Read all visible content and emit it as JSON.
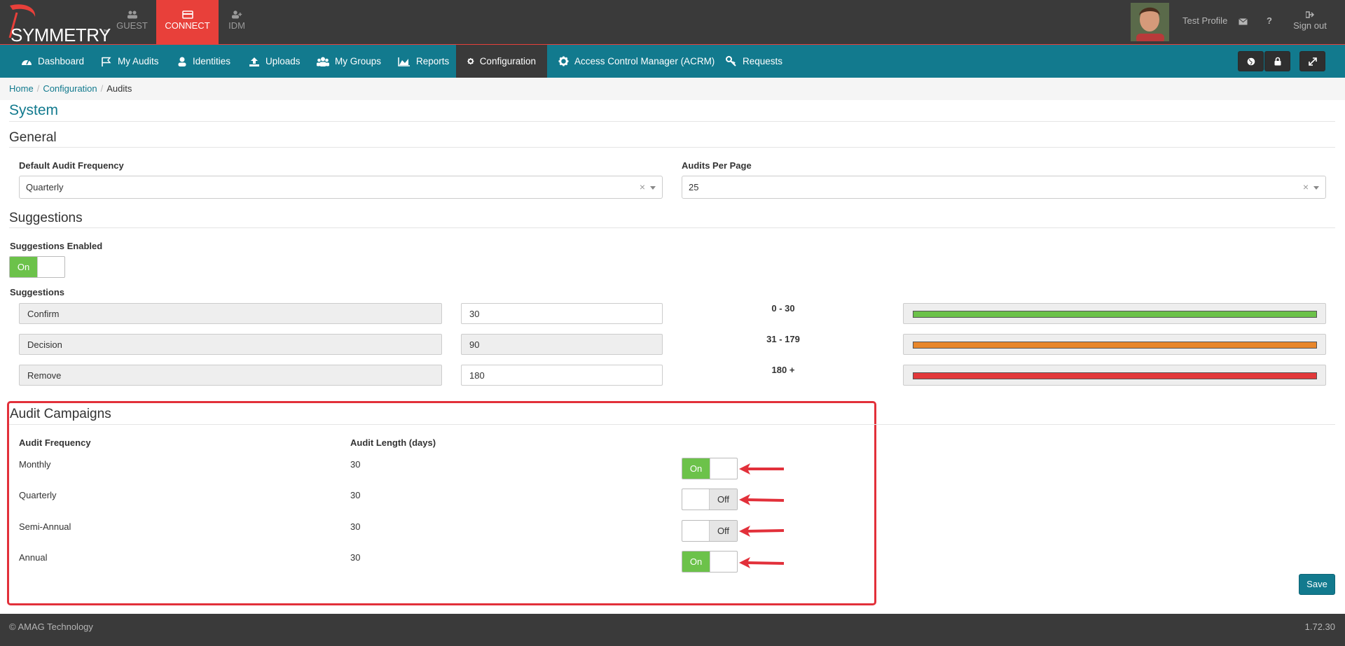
{
  "header": {
    "brand": "SYMMETRY",
    "brand_tm": "™",
    "apps": [
      {
        "label": "GUEST",
        "icon": "users-icon"
      },
      {
        "label": "CONNECT",
        "icon": "card-icon",
        "active": true
      },
      {
        "label": "IDM",
        "icon": "user-add-icon"
      }
    ],
    "profile_name": "Test Profile",
    "help": "?",
    "signout": "Sign out"
  },
  "nav": {
    "items": [
      {
        "label": "Dashboard",
        "icon": "dashboard-icon"
      },
      {
        "label": "My Audits",
        "icon": "flag-icon"
      },
      {
        "label": "Identities",
        "icon": "user-icon"
      },
      {
        "label": "Uploads",
        "icon": "upload-icon"
      },
      {
        "label": "My Groups",
        "icon": "group-icon"
      },
      {
        "label": "Reports",
        "icon": "area-chart-icon"
      },
      {
        "label": "Configuration",
        "icon": "gear-icon",
        "active": true
      },
      {
        "label": "Access Control Manager (ACRM)",
        "icon": "gear-icon"
      },
      {
        "label": "Requests",
        "icon": "key-icon"
      }
    ],
    "right_buttons": [
      "globe-icon",
      "lock-icon",
      "expand-icon"
    ]
  },
  "breadcrumb": [
    "Home",
    "Configuration",
    "Audits"
  ],
  "page_title": "System",
  "general": {
    "title": "General",
    "default_freq_label": "Default Audit Frequency",
    "default_freq_value": "Quarterly",
    "per_page_label": "Audits Per Page",
    "per_page_value": "25",
    "clear": "×"
  },
  "suggestions": {
    "title": "Suggestions",
    "enabled_label": "Suggestions Enabled",
    "enabled_on": "On",
    "list_label": "Suggestions",
    "rows": [
      {
        "name": "Confirm",
        "value": "30",
        "range": "0 - 30",
        "color": "#6cc24a",
        "editable": true
      },
      {
        "name": "Decision",
        "value": "90",
        "range": "31 - 179",
        "color": "#e8862a",
        "editable": false
      },
      {
        "name": "Remove",
        "value": "180",
        "range": "180 +",
        "color": "#e2383a",
        "editable": true
      }
    ]
  },
  "campaigns": {
    "title": "Audit Campaigns",
    "col_freq": "Audit Frequency",
    "col_length": "Audit Length (days)",
    "rows": [
      {
        "freq": "Monthly",
        "length": "30",
        "state": "On"
      },
      {
        "freq": "Quarterly",
        "length": "30",
        "state": "Off"
      },
      {
        "freq": "Semi-Annual",
        "length": "30",
        "state": "Off"
      },
      {
        "freq": "Annual",
        "length": "30",
        "state": "On"
      }
    ],
    "highlight_color": "#e2303a"
  },
  "save_label": "Save",
  "footer": {
    "copyright": "© AMAG Technology",
    "version": "1.72.30"
  }
}
